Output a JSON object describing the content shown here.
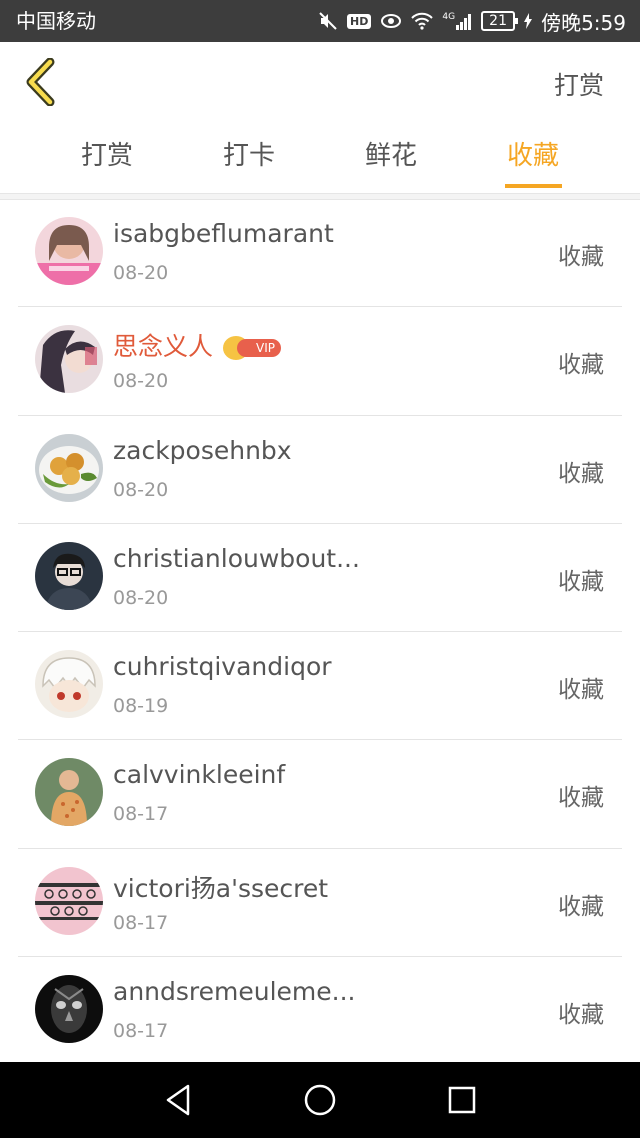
{
  "status_bar": {
    "carrier": "中国移动",
    "network": "4G",
    "battery": "21",
    "time": "傍晚5:59",
    "icons": [
      "mute-icon",
      "hd-icon",
      "eye-icon",
      "wifi-icon",
      "signal-icon",
      "battery-icon",
      "charging-icon"
    ]
  },
  "header": {
    "back_icon": "chevron-left-icon",
    "action_label": "打赏"
  },
  "tabs": [
    {
      "label": "打赏",
      "active": false
    },
    {
      "label": "打卡",
      "active": false
    },
    {
      "label": "鲜花",
      "active": false
    },
    {
      "label": "收藏",
      "active": true
    }
  ],
  "colors": {
    "accent": "#f5a623",
    "vip_name": "#e05a3a",
    "status_bar": "#3d3d3d"
  },
  "list": {
    "items": [
      {
        "name": "isabgbeflumarant",
        "date": "08-20",
        "action": "收藏",
        "vip": false
      },
      {
        "name": "思念义人",
        "date": "08-20",
        "action": "收藏",
        "vip": true,
        "vip_label": "VIP"
      },
      {
        "name": "zackposehnbx",
        "date": "08-20",
        "action": "收藏",
        "vip": false
      },
      {
        "name": "christianlouwbout...",
        "date": "08-20",
        "action": "收藏",
        "vip": false
      },
      {
        "name": "cuhristqivandiqor",
        "date": "08-19",
        "action": "收藏",
        "vip": false
      },
      {
        "name": "calvvinkleeinf",
        "date": "08-17",
        "action": "收藏",
        "vip": false
      },
      {
        "name": "victori扬a'ssecret",
        "date": "08-17",
        "action": "收藏",
        "vip": false
      },
      {
        "name": "anndsremeuleme...",
        "date": "08-17",
        "action": "收藏",
        "vip": false
      }
    ]
  },
  "nav_bar": {
    "buttons": [
      "back-triangle-icon",
      "home-circle-icon",
      "recents-square-icon"
    ]
  }
}
